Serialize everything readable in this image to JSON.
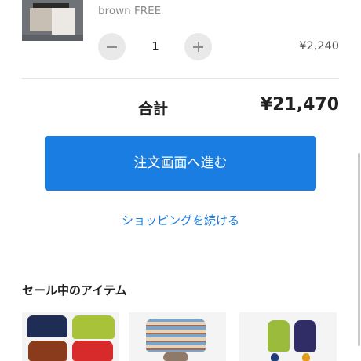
{
  "cart_item": {
    "variant": "brown FREE",
    "quantity": "1",
    "price": "¥2,240",
    "icons": {
      "decrease": "minus-icon",
      "increase": "plus-icon"
    }
  },
  "summary": {
    "total_label": "合計",
    "total_value": "¥21,470"
  },
  "actions": {
    "checkout_label": "注文画面へ進む",
    "continue_label": "ショッピングを続ける"
  },
  "sale_section": {
    "title": "セール中のアイテム"
  },
  "colors": {
    "accent": "#1a7de2",
    "divider": "#e2e2e2",
    "qty_button_bg": "#e9e9e9"
  }
}
